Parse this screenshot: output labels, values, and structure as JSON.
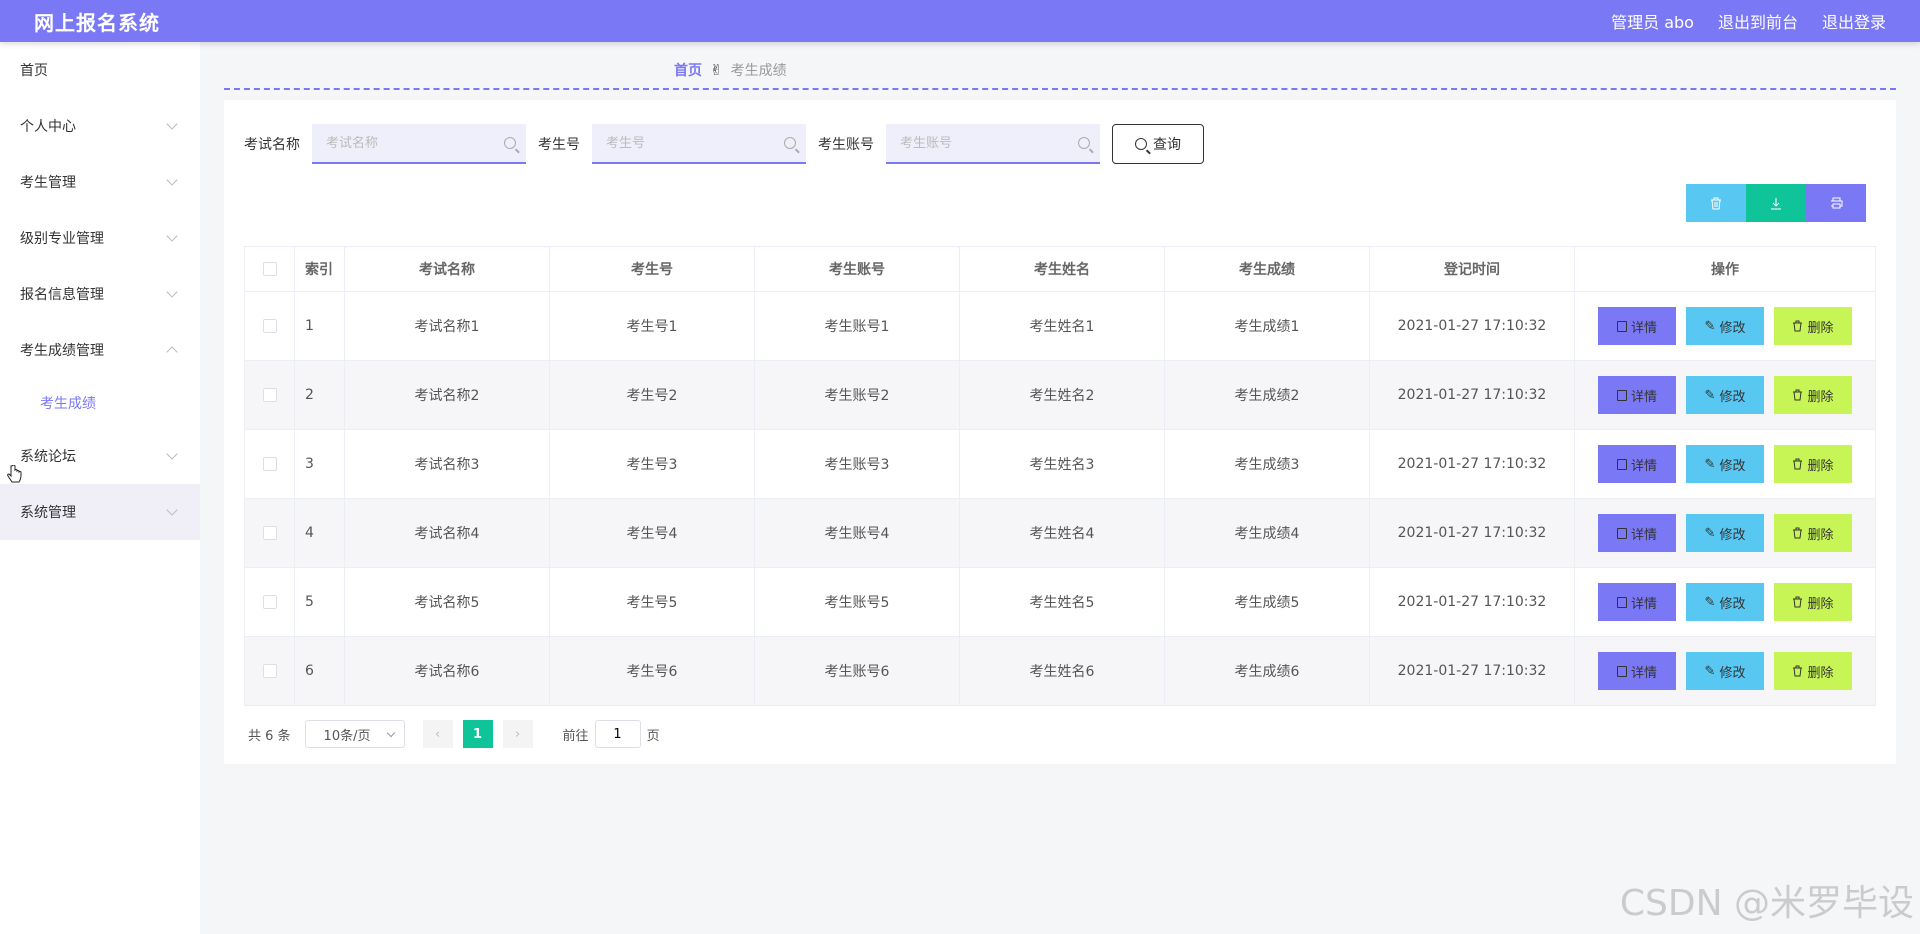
{
  "header": {
    "title": "网上报名系统",
    "admin_label": "管理员 abo",
    "back_label": "退出到前台",
    "logout_label": "退出登录"
  },
  "sidebar": {
    "items": [
      {
        "label": "首页"
      },
      {
        "label": "个人中心"
      },
      {
        "label": "考生管理"
      },
      {
        "label": "级别专业管理"
      },
      {
        "label": "报名信息管理"
      },
      {
        "label": "考生成绩管理"
      },
      {
        "label": "考生成绩"
      },
      {
        "label": "系统论坛"
      },
      {
        "label": "系统管理"
      }
    ]
  },
  "breadcrumb": {
    "home": "首页",
    "separator_icon": "hand-icon",
    "current": "考生成绩"
  },
  "search": {
    "exam_label": "考试名称",
    "exam_placeholder": "考试名称",
    "no_label": "考生号",
    "no_placeholder": "考生号",
    "account_label": "考生账号",
    "account_placeholder": "考生账号",
    "query_label": "查询"
  },
  "toolbar": {
    "delete_icon": "trash-icon",
    "export_icon": "download-icon",
    "print_icon": "printer-icon"
  },
  "table": {
    "headers": [
      "索引",
      "考试名称",
      "考生号",
      "考生账号",
      "考生姓名",
      "考生成绩",
      "登记时间",
      "操作"
    ],
    "rows": [
      {
        "idx": "1",
        "exam": "考试名称1",
        "no": "考生号1",
        "account": "考生账号1",
        "name": "考生姓名1",
        "score": "考生成绩1",
        "time": "2021-01-27 17:10:32"
      },
      {
        "idx": "2",
        "exam": "考试名称2",
        "no": "考生号2",
        "account": "考生账号2",
        "name": "考生姓名2",
        "score": "考生成绩2",
        "time": "2021-01-27 17:10:32"
      },
      {
        "idx": "3",
        "exam": "考试名称3",
        "no": "考生号3",
        "account": "考生账号3",
        "name": "考生姓名3",
        "score": "考生成绩3",
        "time": "2021-01-27 17:10:32"
      },
      {
        "idx": "4",
        "exam": "考试名称4",
        "no": "考生号4",
        "account": "考生账号4",
        "name": "考生姓名4",
        "score": "考生成绩4",
        "time": "2021-01-27 17:10:32"
      },
      {
        "idx": "5",
        "exam": "考试名称5",
        "no": "考生号5",
        "account": "考生账号5",
        "name": "考生姓名5",
        "score": "考生成绩5",
        "time": "2021-01-27 17:10:32"
      },
      {
        "idx": "6",
        "exam": "考试名称6",
        "no": "考生号6",
        "account": "考生账号6",
        "name": "考生姓名6",
        "score": "考生成绩6",
        "time": "2021-01-27 17:10:32"
      }
    ],
    "actions": {
      "detail": "详情",
      "edit": "修改",
      "delete": "删除"
    }
  },
  "pagination": {
    "total": "共 6 条",
    "page_size": "10条/页",
    "current_page": "1",
    "goto_label": "前往",
    "goto_value": "1",
    "page_suffix": "页"
  },
  "watermark": "CSDN @米罗毕设",
  "colors": {
    "accent": "#7b78f5",
    "success": "#10c49a",
    "info": "#58c7f2",
    "lime": "#c8f556"
  }
}
